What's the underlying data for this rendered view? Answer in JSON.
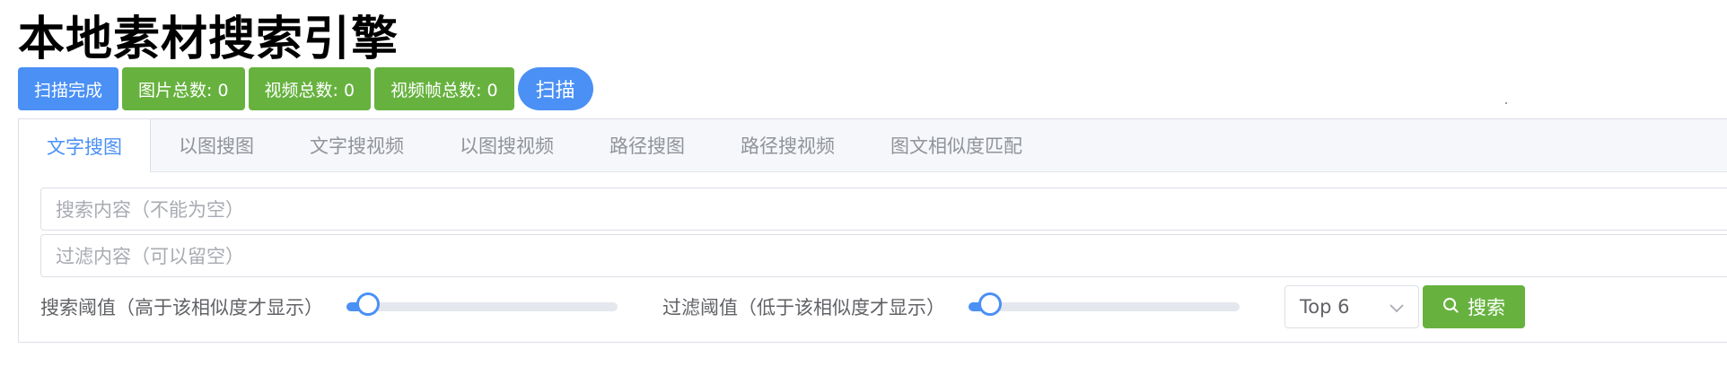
{
  "page": {
    "title": "本地素材搜索引擎"
  },
  "status": {
    "scan_state": "扫描完成",
    "image_count": "图片总数: 0",
    "video_count": "视频总数: 0",
    "frame_count": "视频帧总数: 0",
    "scan_button": "扫描"
  },
  "tabs": [
    {
      "label": "文字搜图",
      "active": true
    },
    {
      "label": "以图搜图",
      "active": false
    },
    {
      "label": "文字搜视频",
      "active": false
    },
    {
      "label": "以图搜视频",
      "active": false
    },
    {
      "label": "路径搜图",
      "active": false
    },
    {
      "label": "路径搜视频",
      "active": false
    },
    {
      "label": "图文相似度匹配",
      "active": false
    }
  ],
  "search": {
    "query_placeholder": "搜索内容（不能为空）",
    "filter_placeholder": "过滤内容（可以留空）",
    "threshold_label": "搜索阈值（高于该相似度才显示）",
    "threshold_level": 0.08,
    "filter_threshold_label": "过滤阈值（低于该相似度才显示）",
    "filter_threshold_level": 0.08,
    "topk_value": "Top 6",
    "search_button": "搜索"
  },
  "colors": {
    "primary": "#4a90f5",
    "success": "#67b23f"
  },
  "icons": {
    "dropdown": "chevron-down-icon",
    "search": "search-icon"
  }
}
